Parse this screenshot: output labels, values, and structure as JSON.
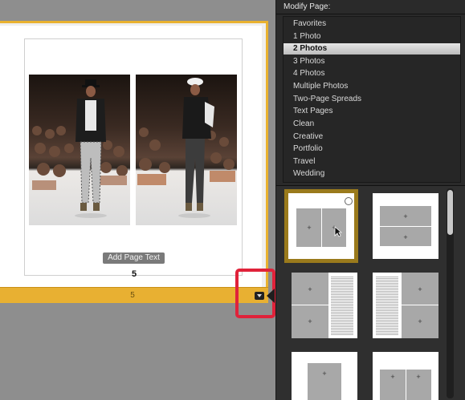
{
  "canvas": {
    "add_page_text_label": "Add Page Text",
    "page_number": "5",
    "strip_page_number": "5"
  },
  "panel": {
    "title": "Modify Page:",
    "categories": [
      {
        "label": "Favorites"
      },
      {
        "label": "1 Photo"
      },
      {
        "label": "2 Photos",
        "selected": true
      },
      {
        "label": "3 Photos"
      },
      {
        "label": "4 Photos"
      },
      {
        "label": "Multiple Photos"
      },
      {
        "label": "Two-Page Spreads"
      },
      {
        "label": "Text Pages"
      },
      {
        "label": "Clean"
      },
      {
        "label": "Creative"
      },
      {
        "label": "Portfolio"
      },
      {
        "label": "Travel"
      },
      {
        "label": "Wedding"
      }
    ],
    "layout_cross_glyph": "+"
  },
  "colors": {
    "page_strip": "#e8b032",
    "highlight": "#e0223a",
    "selected_layout_border": "#9a7a1c",
    "panel_bg": "#2a2a2a"
  },
  "icons": [
    "dropdown-arrow-icon",
    "pointer-arrow-icon",
    "cursor-icon",
    "selection-circle-icon"
  ]
}
